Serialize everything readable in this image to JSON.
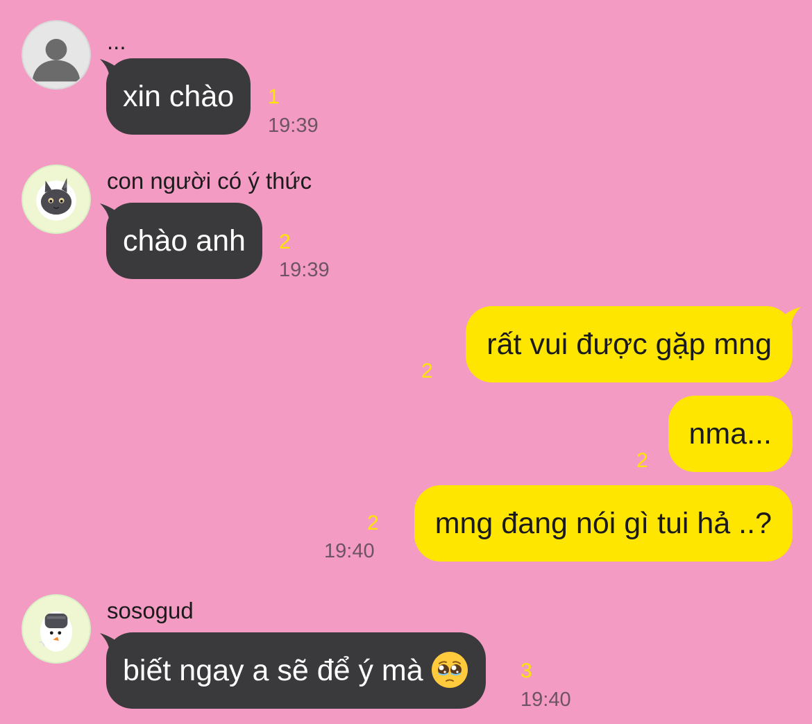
{
  "colors": {
    "background": "#F39BC3",
    "incoming_bubble": "#3A3A3C",
    "outgoing_bubble": "#FFE600",
    "unread_count": "#FFE600",
    "timestamp": "#6E5363"
  },
  "messages": [
    {
      "sender": "...",
      "avatar_icon": "default-person-avatar-icon",
      "text": "xin chào",
      "unread": "1",
      "time": "19:39"
    },
    {
      "sender": "con người có ý thức",
      "avatar_icon": "gray-cat-avatar-icon",
      "text": "chào anh",
      "unread": "2",
      "time": "19:39"
    },
    {
      "outgoing": true,
      "text": "rất vui được gặp mng",
      "unread": "2"
    },
    {
      "outgoing": true,
      "text": "nma...",
      "unread": "2"
    },
    {
      "outgoing": true,
      "text": "mng đang nói gì tui hả ..?",
      "unread": "2",
      "time": "19:40"
    },
    {
      "sender": "sosogud",
      "avatar_icon": "character-avatar-icon",
      "text": "biết ngay a sẽ để ý mà",
      "emoji": "pleading-face-emoji",
      "unread": "3",
      "time": "19:40"
    }
  ]
}
